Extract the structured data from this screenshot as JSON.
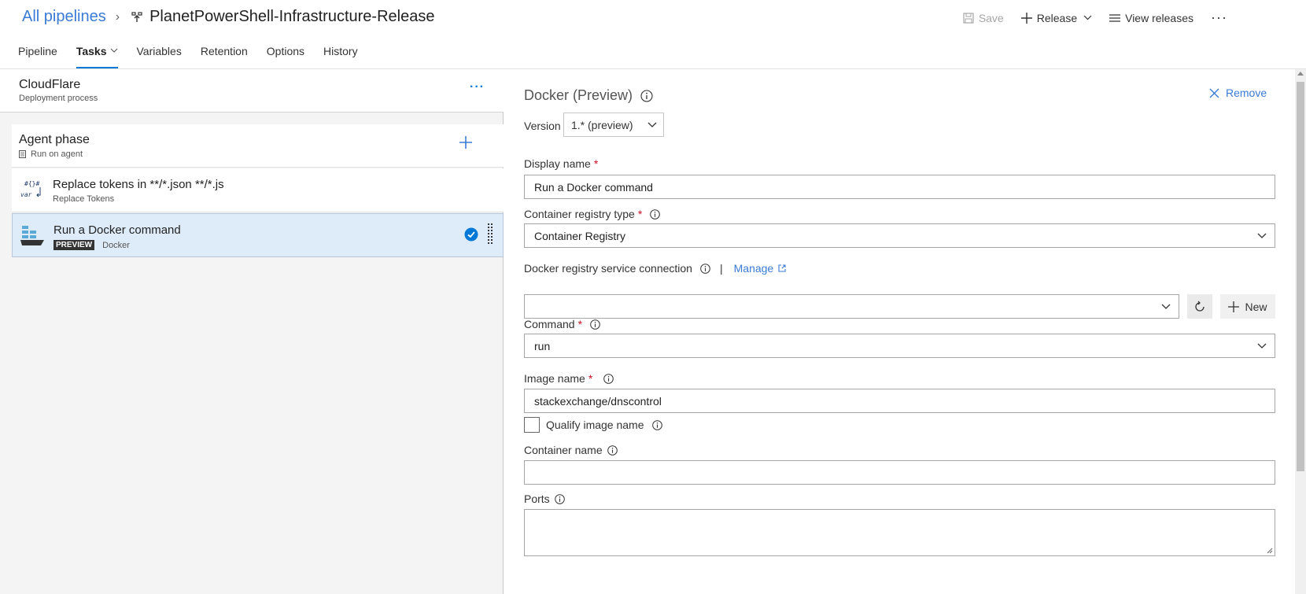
{
  "header": {
    "breadcrumb_root": "All pipelines",
    "pipeline_name": "PlanetPowerShell-Infrastructure-Release",
    "actions": {
      "save": "Save",
      "release": "Release",
      "view_releases": "View releases",
      "more": "···"
    }
  },
  "tabs": [
    {
      "label": "Pipeline"
    },
    {
      "label": "Tasks"
    },
    {
      "label": "Variables"
    },
    {
      "label": "Retention"
    },
    {
      "label": "Options"
    },
    {
      "label": "History"
    }
  ],
  "left": {
    "stage": {
      "name": "CloudFlare",
      "subtitle": "Deployment process",
      "more": "···"
    },
    "phase": {
      "name": "Agent phase",
      "subtitle": "Run on agent"
    },
    "tasks": [
      {
        "name": "Replace tokens in **/*.json **/*.js",
        "subtitle": "Replace Tokens",
        "icon": "replace-tokens-icon"
      },
      {
        "name": "Run a Docker command",
        "badge": "PREVIEW",
        "subtitle": "Docker",
        "icon": "docker-icon"
      }
    ]
  },
  "right": {
    "title": "Docker (Preview)",
    "remove": "Remove",
    "version_label": "Version",
    "version_value": "1.* (preview)",
    "fields": {
      "display_name": {
        "label": "Display name",
        "value": "Run a Docker command"
      },
      "registry_type": {
        "label": "Container registry type",
        "value": "Container Registry"
      },
      "service_connection": {
        "label": "Docker registry service connection",
        "manage": "Manage",
        "separator": "|",
        "value": "",
        "new": "New"
      },
      "command": {
        "label": "Command",
        "value": "run"
      },
      "image_name": {
        "label": "Image name",
        "value": "stackexchange/dnscontrol"
      },
      "qualify": {
        "label": "Qualify image name",
        "checked": false
      },
      "container_name": {
        "label": "Container name",
        "value": ""
      },
      "ports": {
        "label": "Ports",
        "value": ""
      }
    },
    "required_mark": "*"
  },
  "colors": {
    "accent": "#0078d7",
    "link": "#3a7bd5",
    "selected_row": "#deecf9",
    "required": "#c50f1f"
  }
}
